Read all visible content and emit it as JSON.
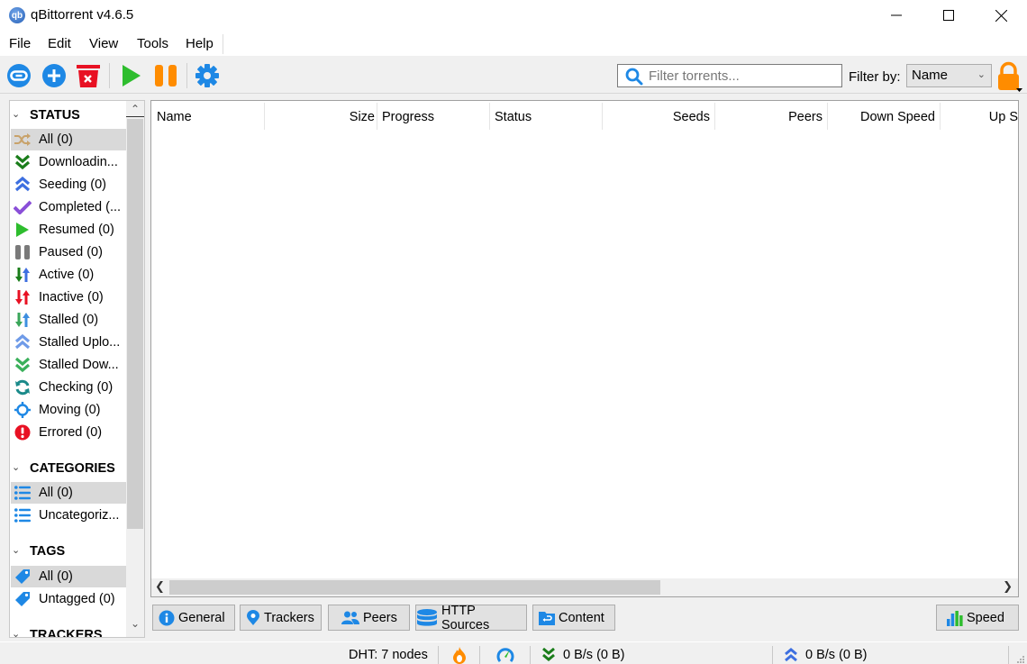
{
  "window": {
    "app_icon_text": "qb",
    "title": "qBittorrent v4.6.5"
  },
  "menu": [
    "File",
    "Edit",
    "View",
    "Tools",
    "Help"
  ],
  "toolbar": {
    "buttons": [
      {
        "name": "add-torrent-link",
        "icon": "link-icon"
      },
      {
        "name": "add-torrent-file",
        "icon": "plus-circle-icon"
      },
      {
        "name": "delete-torrent",
        "icon": "trash-icon"
      },
      {
        "name": "resume",
        "icon": "play-icon"
      },
      {
        "name": "pause",
        "icon": "pause-icon"
      },
      {
        "name": "options",
        "icon": "gear-icon"
      }
    ],
    "filter_placeholder": "Filter torrents...",
    "filter_value": "",
    "filter_by_label": "Filter by:",
    "filter_by_selected": "Name"
  },
  "sidebar": {
    "status": {
      "title": "STATUS",
      "items": [
        {
          "label": "All (0)",
          "icon": "shuffle-icon",
          "selected": true
        },
        {
          "label": "Downloadin...",
          "icon": "double-chevron-down-icon"
        },
        {
          "label": "Seeding (0)",
          "icon": "double-chevron-up-icon"
        },
        {
          "label": "Completed (...",
          "icon": "checkmark-icon"
        },
        {
          "label": "Resumed (0)",
          "icon": "play-icon"
        },
        {
          "label": "Paused (0)",
          "icon": "pause-icon"
        },
        {
          "label": "Active (0)",
          "icon": "up-down-arrows-icon"
        },
        {
          "label": "Inactive (0)",
          "icon": "up-down-arrows-red-icon"
        },
        {
          "label": "Stalled (0)",
          "icon": "up-down-arrows-stalled-icon"
        },
        {
          "label": "Stalled Uplo...",
          "icon": "double-chevron-up-light-icon"
        },
        {
          "label": "Stalled Dow...",
          "icon": "double-chevron-down-light-icon"
        },
        {
          "label": "Checking (0)",
          "icon": "refresh-icon"
        },
        {
          "label": "Moving (0)",
          "icon": "crosshair-icon"
        },
        {
          "label": "Errored (0)",
          "icon": "error-icon"
        }
      ]
    },
    "categories": {
      "title": "CATEGORIES",
      "items": [
        {
          "label": "All (0)",
          "icon": "list-icon",
          "selected": true
        },
        {
          "label": "Uncategoriz...",
          "icon": "list-icon"
        }
      ]
    },
    "tags": {
      "title": "TAGS",
      "items": [
        {
          "label": "All (0)",
          "icon": "tag-icon",
          "selected": true
        },
        {
          "label": "Untagged (0)",
          "icon": "tag-icon"
        }
      ]
    },
    "trackers": {
      "title": "TRACKERS"
    }
  },
  "table": {
    "columns": [
      "Name",
      "Size",
      "Progress",
      "Status",
      "Seeds",
      "Peers",
      "Down Speed",
      "Up S"
    ],
    "rows": []
  },
  "bottom_tabs": [
    "General",
    "Trackers",
    "Peers",
    "HTTP Sources",
    "Content"
  ],
  "speed_button": "Speed",
  "statusbar": {
    "dht": "DHT: 7 nodes",
    "download": "0 B/s (0 B)",
    "upload": "0 B/s (0 B)"
  },
  "colors": {
    "accent_blue": "#1e88e5",
    "green": "#2ebd2e",
    "orange": "#ff8c00",
    "red": "#e81123",
    "selection": "#d9d9d9"
  }
}
